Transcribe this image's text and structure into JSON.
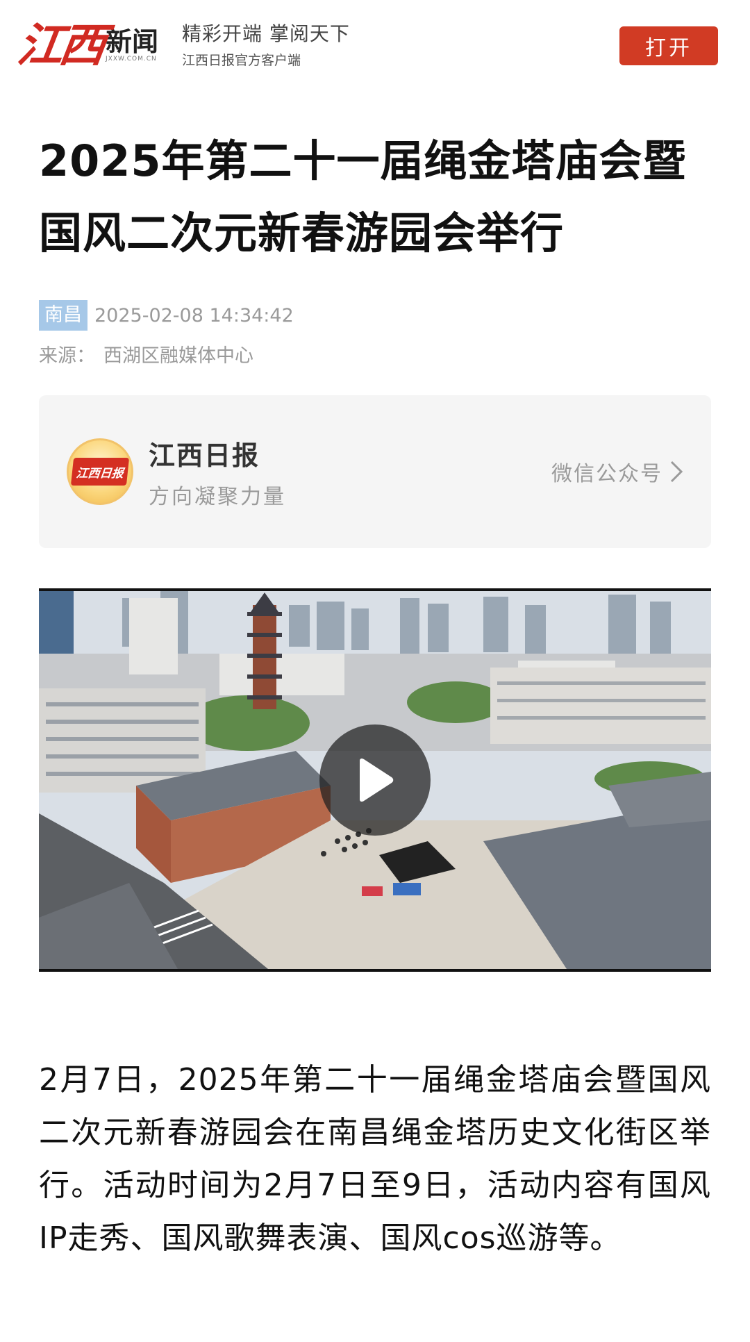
{
  "app_banner": {
    "logo_mark": "江西",
    "logo_word": "新闻",
    "logo_url": "JXXW.COM.CN",
    "slogan": "精彩开端  掌阅天下",
    "subtitle": "江西日报官方客户端",
    "open_label": "打开",
    "accent_color": "#d13b24"
  },
  "article": {
    "title": "2025年第二十一届绳金塔庙会暨国风二次元新春游园会举行",
    "city_tag": "南昌",
    "publish_time": "2025-02-08 14:34:42",
    "source_label": "来源：",
    "source_value": "西湖区融媒体中心",
    "body": "2月7日，2025年第二十一届绳金塔庙会暨国风二次元新春游园会在南昌绳金塔历史文化街区举行。活动时间为2月7日至9日，活动内容有国风IP走秀、国风歌舞表演、国风cos巡游等。"
  },
  "account_card": {
    "avatar_text": "江西日报",
    "name": "江西日报",
    "description": "方向凝聚力量",
    "link_label": "微信公众号",
    "link_icon": "chevron-right-icon"
  },
  "video": {
    "play_icon": "play-icon"
  }
}
